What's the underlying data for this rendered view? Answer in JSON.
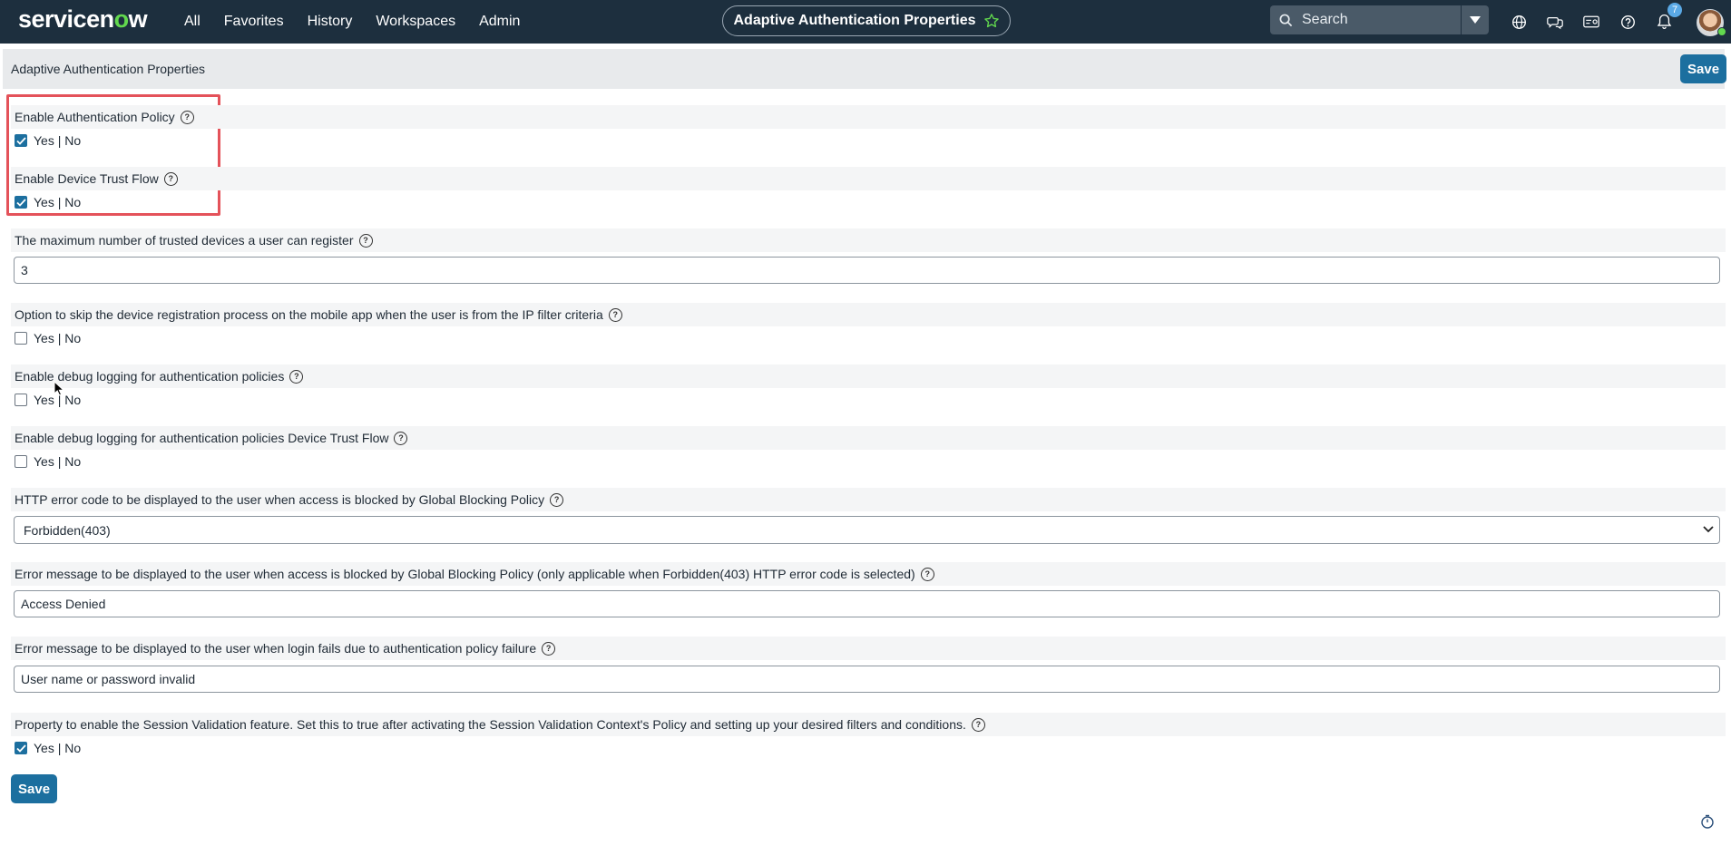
{
  "nav": {
    "logo_prefix": "servicen",
    "logo_o": "o",
    "logo_suffix": "w",
    "links": [
      "All",
      "Favorites",
      "History",
      "Workspaces",
      "Admin"
    ],
    "page_pill": "Adaptive Authentication Properties",
    "search_placeholder": "Search",
    "notification_count": "7",
    "icons": [
      "globe-icon",
      "chat-icon",
      "id-card-icon",
      "help-icon",
      "bell-icon"
    ]
  },
  "form": {
    "header_title": "Adaptive Authentication Properties",
    "save_label": "Save"
  },
  "yes_no": "Yes | No",
  "properties": [
    {
      "label": "Enable Authentication Policy",
      "type": "checkbox",
      "checked": true
    },
    {
      "label": "Enable Device Trust Flow",
      "type": "checkbox",
      "checked": true
    },
    {
      "label": "The maximum number of trusted devices a user can register",
      "type": "text",
      "value": "3"
    },
    {
      "label": "Option to skip the device registration process on the mobile app when the user is from the IP filter criteria",
      "type": "checkbox",
      "checked": false
    },
    {
      "label": "Enable debug logging for authentication policies",
      "type": "checkbox",
      "checked": false
    },
    {
      "label": "Enable debug logging for authentication policies Device Trust Flow",
      "type": "checkbox",
      "checked": false
    },
    {
      "label": "HTTP error code to be displayed to the user when access is blocked by Global Blocking Policy",
      "type": "select",
      "value": "Forbidden(403)"
    },
    {
      "label": "Error message to be displayed to the user when access is blocked by Global Blocking Policy (only applicable when Forbidden(403) HTTP error code is selected)",
      "type": "text",
      "value": "Access Denied"
    },
    {
      "label": "Error message to be displayed to the user when login fails due to authentication policy failure",
      "type": "text",
      "value": "User name or password invalid"
    },
    {
      "label": "Property to enable the Session Validation feature. Set this to true after activating the Session Validation Context's Policy and setting up your desired filters and conditions.",
      "type": "checkbox",
      "checked": true
    }
  ],
  "colors": {
    "nav_bg": "#1d2f3e",
    "accent": "#1c6f9f",
    "highlight": "#e4525a",
    "brand_green": "#62d84e"
  }
}
